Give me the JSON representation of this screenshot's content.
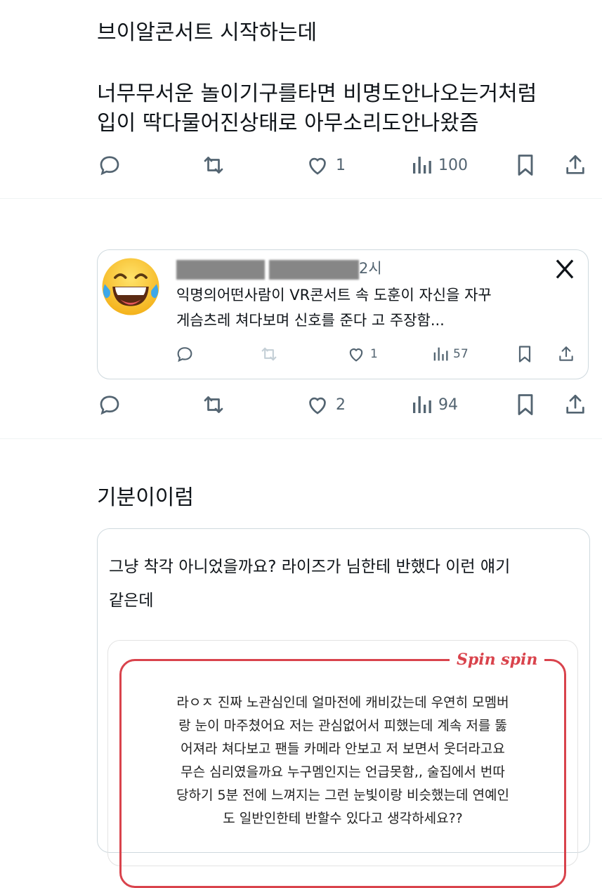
{
  "tweet1": {
    "line1": "브이알콘서트 시작하는데",
    "line2": "너무무서운 놀이기구를타면 비명도안나오는거처럼",
    "line3": "입이 딱다물어진상태로 아무소리도안나왔즘",
    "actions": {
      "likes": "1",
      "views": "100"
    }
  },
  "tweet2": {
    "quote": {
      "time_suffix": "2시",
      "line1": "익명의어떤사람이  VR콘서트 속 도훈이 자신을 자꾸",
      "line2": "게슴츠레 쳐다보며 신호를 준다  고 주장함...",
      "actions": {
        "likes": "1",
        "views": "57"
      }
    },
    "actions": {
      "likes": "2",
      "views": "94"
    }
  },
  "tweet3": {
    "text": "기분이이럼",
    "card": {
      "line1": "그냥 착각 아니었을까요? 라이즈가 님한테 반했다 이런 얘기",
      "line2": "같은데",
      "brand": "Spin spin",
      "body_lines": [
        "라ㅇㅈ 진짜 노관심인데 얼마전에 캐비갔는데 우연히 모멤버",
        "랑 눈이 마주쳤어요 저는 관심없어서 피했는데 계속 저를 뚫",
        "어져라 쳐다보고 팬들 카메라 안보고 저 보면서 웃더라고요",
        "무슨 심리였을까요 누구멤인지는 언급못함,, 술집에서 번따",
        "당하기 5분 전에 느껴지는 그런 눈빛이랑 비슷했는데 연예인",
        "도 일반인한테 반할수 있다고 생각하세요??"
      ]
    }
  },
  "colors": {
    "text": "#0f1419",
    "muted": "#536471",
    "accent_red": "#d9434c",
    "border": "#cfd9de"
  },
  "icons": [
    "reply-icon",
    "retweet-icon",
    "like-icon",
    "views-icon",
    "bookmark-icon",
    "share-icon",
    "x-logo-icon",
    "laughing-emoji-icon"
  ]
}
